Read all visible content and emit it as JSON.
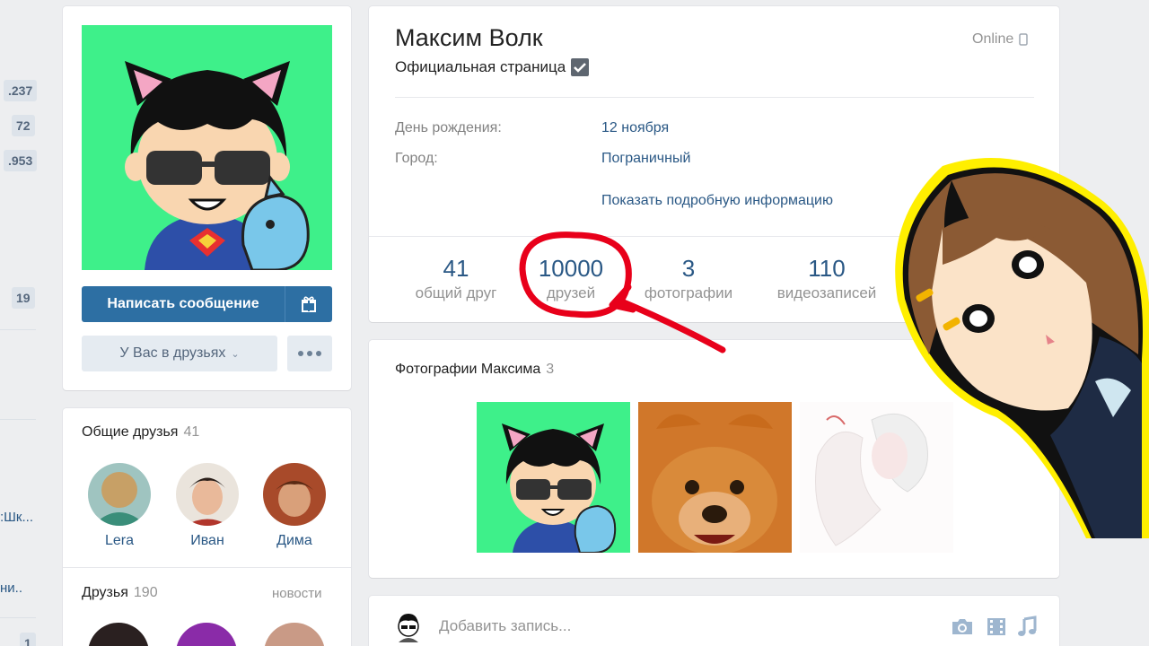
{
  "left_strip": {
    "badges": [
      ".237",
      "72",
      ".953",
      "19",
      "1"
    ],
    "texts": [
      ":Шк...",
      "ни.."
    ]
  },
  "profile_actions": {
    "message_button": "Написать сообщение",
    "gift_icon": "gift-icon",
    "friends_button": "У Вас в друзьях",
    "more_icon": "more-dots-icon"
  },
  "mutual_friends": {
    "title": "Общие друзья",
    "count": "41",
    "items": [
      {
        "name": "Lera"
      },
      {
        "name": "Иван"
      },
      {
        "name": "Дима"
      }
    ]
  },
  "friends": {
    "title": "Друзья",
    "count": "190",
    "news_link": "новости"
  },
  "profile": {
    "name": "Максим Волк",
    "status": "Официальная страница",
    "online": "Online",
    "rows": [
      {
        "label": "День рождения:",
        "value": "12 ноября"
      },
      {
        "label": "Город:",
        "value": "Пограничный"
      }
    ],
    "more_info": "Показать подробную информацию"
  },
  "counters": [
    {
      "num": "41",
      "label": "общий друг"
    },
    {
      "num": "10000",
      "label": "друзей"
    },
    {
      "num": "3",
      "label": "фотографии"
    },
    {
      "num": "110",
      "label": "видеозаписей"
    }
  ],
  "photos": {
    "title": "Фотографии Максима",
    "count": "3"
  },
  "post_box": {
    "placeholder": "Добавить запись..."
  },
  "colors": {
    "link": "#2a5885",
    "accent_button": "#2d6fa3",
    "annotation_red": "#e8001a",
    "avatar_bg": "#3ef08a"
  }
}
